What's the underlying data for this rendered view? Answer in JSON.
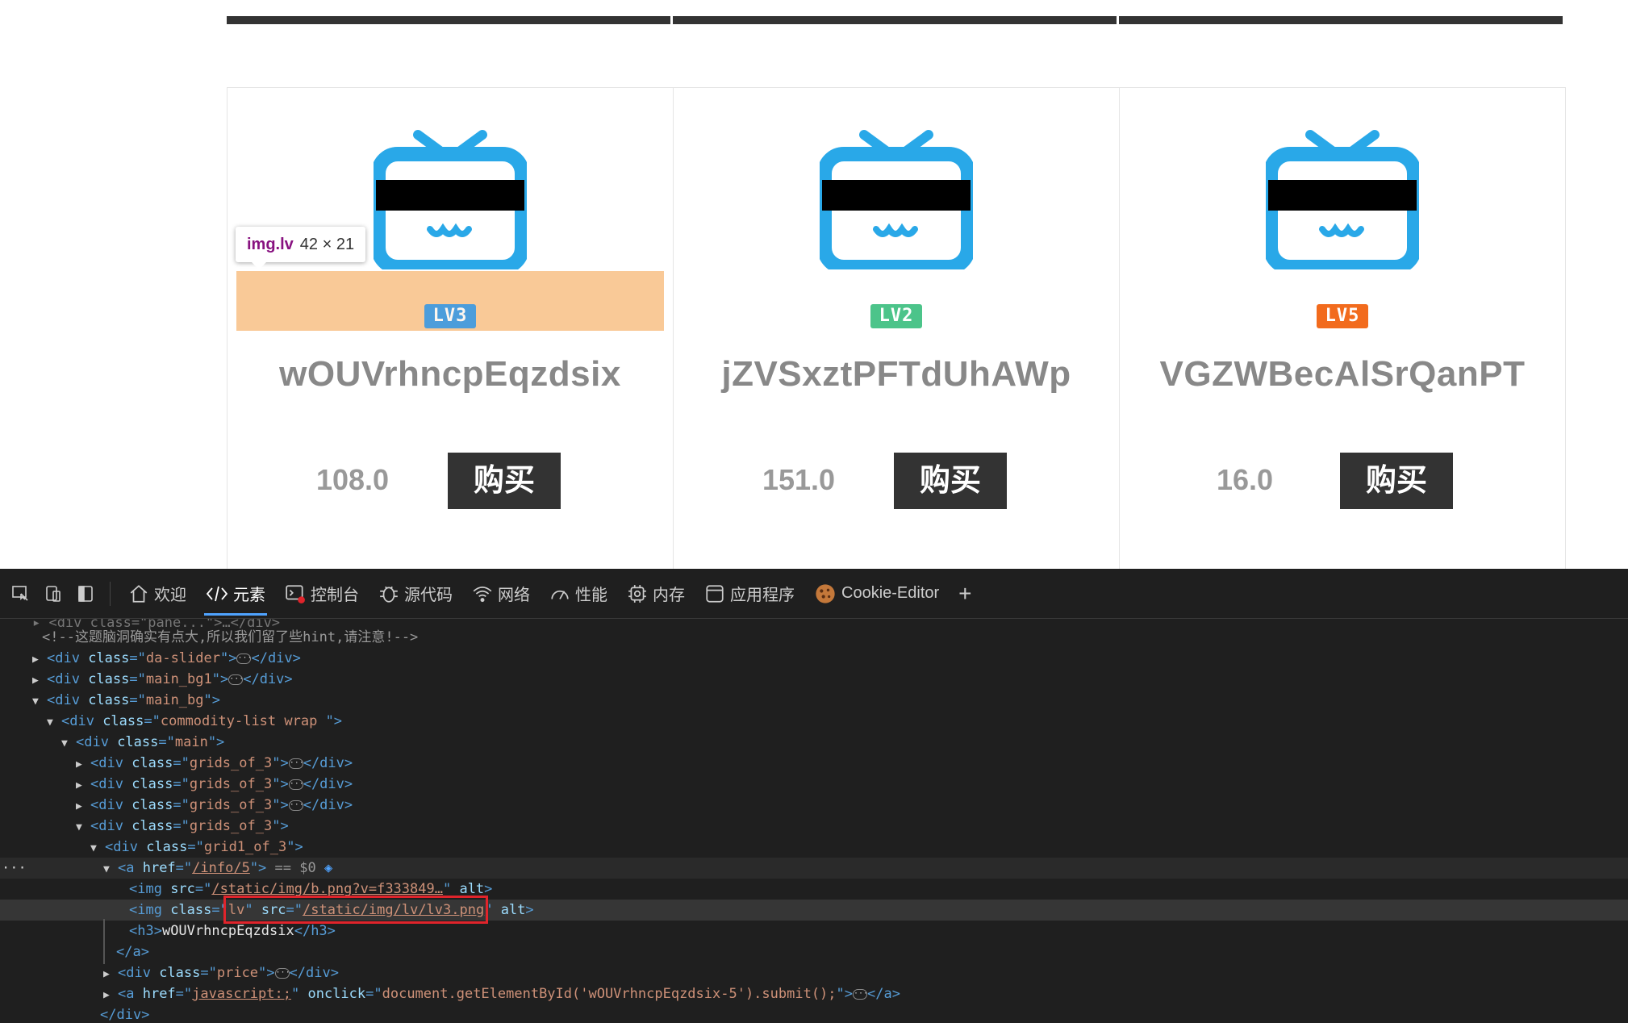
{
  "products": [
    {
      "name": "wOUVrhncpEqzdsix",
      "price": "108.0",
      "buy_label": "购买",
      "level": "LV3",
      "level_color": "#2f96e8",
      "highlighted": true
    },
    {
      "name": "jZVSxztPFTdUhAWp",
      "price": "151.0",
      "buy_label": "购买",
      "level": "LV2",
      "level_color": "#4cc48a",
      "highlighted": false
    },
    {
      "name": "VGZWBecAlSrQanPT",
      "price": "16.0",
      "buy_label": "购买",
      "level": "LV5",
      "level_color": "#f26b1d",
      "highlighted": false
    }
  ],
  "inspector_tooltip": {
    "selector": "img.lv",
    "size": "42 × 21"
  },
  "devtools": {
    "tabs": [
      {
        "label": "欢迎",
        "icon": "home-icon"
      },
      {
        "label": "元素",
        "icon": "code-icon",
        "active": true
      },
      {
        "label": "控制台",
        "icon": "console-icon"
      },
      {
        "label": "源代码",
        "icon": "bug-icon"
      },
      {
        "label": "网络",
        "icon": "wifi-icon"
      },
      {
        "label": "性能",
        "icon": "gauge-icon"
      },
      {
        "label": "内存",
        "icon": "chip-icon"
      },
      {
        "label": "应用程序",
        "icon": "window-icon"
      },
      {
        "label": "Cookie-Editor",
        "icon": "cookie-icon"
      }
    ],
    "add_tab_label": "+",
    "tree": {
      "comment": "<!--这题脑洞确实有点大,所以我们留了些hint,请注意!-->",
      "dom_selected_marker": "== $0",
      "nodes": {
        "da_slider": "da-slider",
        "main_bg1": "main_bg1",
        "main_bg": "main_bg",
        "commodity_list": "commodity-list wrap ",
        "main": "main",
        "grids_of_3": "grids_of_3",
        "grid1_of_3": "grid1_of_3",
        "info_href": "/info/5",
        "img_src": "/static/img/b.png?v=f333849…",
        "img_class": "lv",
        "img_lv_src": "/static/img/lv/lv3.png",
        "h3_text": "wOUVrhncpEqzdsix",
        "price_class": "price",
        "js_href": "javascript:;",
        "onclick": "document.getElementById('wOUVrhncpEqzdsix-5').submit();"
      }
    }
  }
}
